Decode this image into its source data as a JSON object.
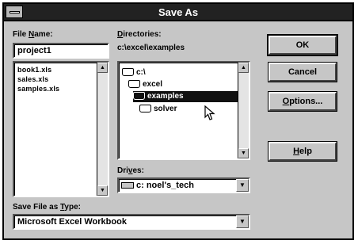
{
  "window": {
    "title": "Save As"
  },
  "file_name": {
    "label_prefix": "File ",
    "label_key": "N",
    "label_suffix": "ame:",
    "value": "project1",
    "files": [
      "book1.xls",
      "sales.xls",
      "samples.xls"
    ]
  },
  "directories": {
    "label_key": "D",
    "label_suffix": "irectories:",
    "path": "c:\\excel\\examples",
    "items": [
      "c:\\",
      "excel",
      "examples",
      "solver"
    ],
    "selected_index": 2
  },
  "drives": {
    "label_prefix": "Dri",
    "label_key": "v",
    "label_suffix": "es:",
    "value": "c: noel's_tech"
  },
  "save_type": {
    "label_prefix": "Save File as ",
    "label_key": "T",
    "label_suffix": "ype:",
    "value": "Microsoft Excel Workbook"
  },
  "buttons": {
    "ok": "OK",
    "cancel": "Cancel",
    "options": "Options...",
    "options_key": "O",
    "options_rest": "ptions...",
    "help": "Help",
    "help_key": "H",
    "help_rest": "elp"
  },
  "icons": {
    "arrow_up": "▲",
    "arrow_down": "▼",
    "drop_arrow": "▼"
  }
}
